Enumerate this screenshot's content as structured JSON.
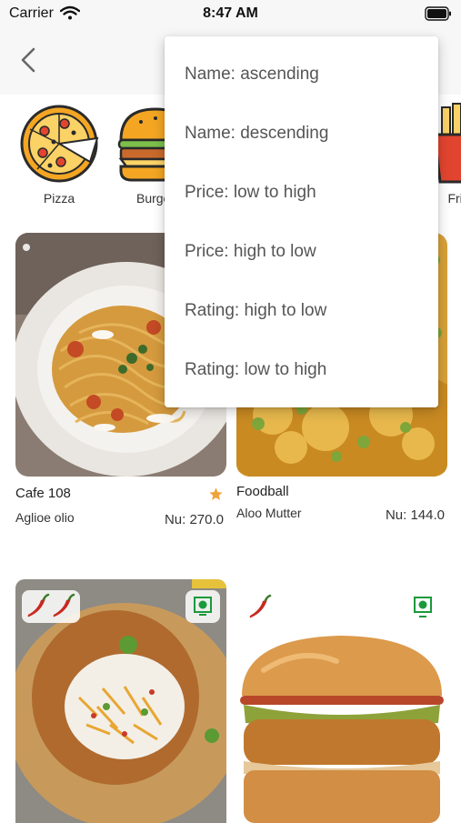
{
  "status_bar": {
    "carrier": "Carrier",
    "time": "8:47 AM"
  },
  "categories": [
    {
      "label": "Pizza",
      "icon": "pizza-icon"
    },
    {
      "label": "Burger",
      "icon": "burger-icon"
    },
    {
      "label": "Fries",
      "icon": "fries-icon"
    }
  ],
  "sort_menu": {
    "options": [
      "Name: ascending",
      "Name: descending",
      "Price: low to high",
      "Price: high to low",
      "Rating: high to low",
      "Rating: low to high"
    ]
  },
  "items": [
    {
      "restaurant": "Cafe 108",
      "dish": "Aglioe olio",
      "price": "Nu: 270.0",
      "starred": true
    },
    {
      "restaurant": "Foodball",
      "dish": "Aloo Mutter",
      "price": "Nu: 144.0",
      "starred": false
    },
    {
      "spice_level": 2,
      "veg": true
    },
    {
      "spice_level": 1,
      "veg": true
    }
  ],
  "colors": {
    "star": "#f0a33a",
    "veg_green": "#1a9a3a",
    "chili_red": "#c8281e"
  }
}
